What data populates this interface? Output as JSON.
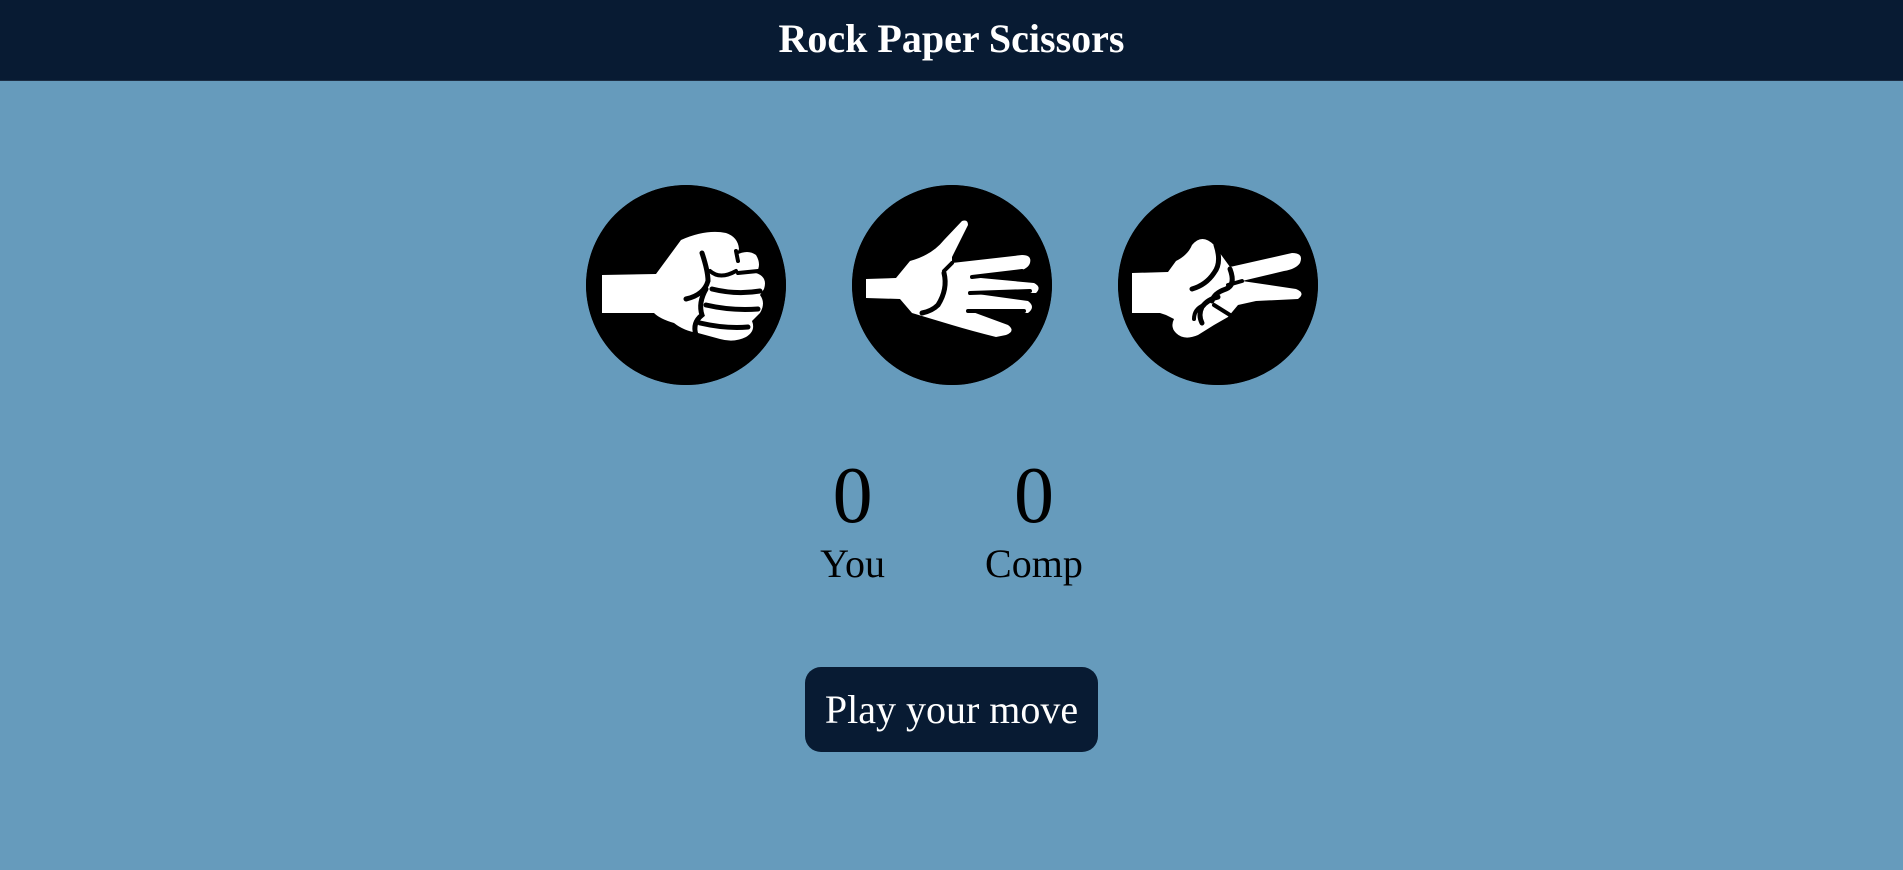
{
  "header": {
    "title": "Rock Paper Scissors"
  },
  "choices": [
    {
      "id": "rock",
      "icon": "rock-fist-icon"
    },
    {
      "id": "paper",
      "icon": "paper-open-hand-icon"
    },
    {
      "id": "scissors",
      "icon": "scissors-two-fingers-icon"
    }
  ],
  "score": {
    "user": {
      "value": "0",
      "label": "You"
    },
    "comp": {
      "value": "0",
      "label": "Comp"
    }
  },
  "message": "Play your move",
  "colors": {
    "background": "#669bbc",
    "header": "#081b33",
    "message_bg": "#081b33",
    "choice_circle": "#000000",
    "text_light": "#ffffff",
    "text_dark": "#000000"
  }
}
